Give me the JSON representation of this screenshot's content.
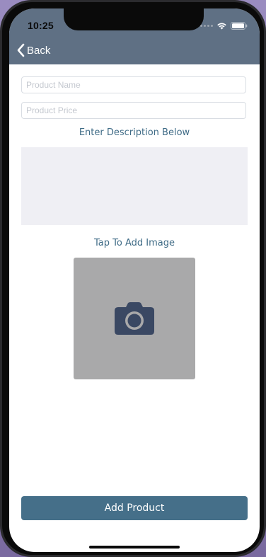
{
  "status_bar": {
    "time": "10:25"
  },
  "nav": {
    "back_label": "Back"
  },
  "form": {
    "product_name_placeholder": "Product Name",
    "product_price_placeholder": "Product Price",
    "description_label": "Enter Description Below",
    "image_label": "Tap To Add Image",
    "submit_label": "Add Product"
  },
  "icons": {
    "back": "chevron-left-icon",
    "image": "camera-icon",
    "wifi": "wifi-icon",
    "battery": "battery-icon",
    "signal": "signal-dots-icon"
  },
  "colors": {
    "header": "#5f7084",
    "accent": "#456f89",
    "label_text": "#3f6b86",
    "description_bg": "#efeff4",
    "image_placeholder_bg": "#a9a9aa",
    "camera_icon": "#3a4863"
  }
}
